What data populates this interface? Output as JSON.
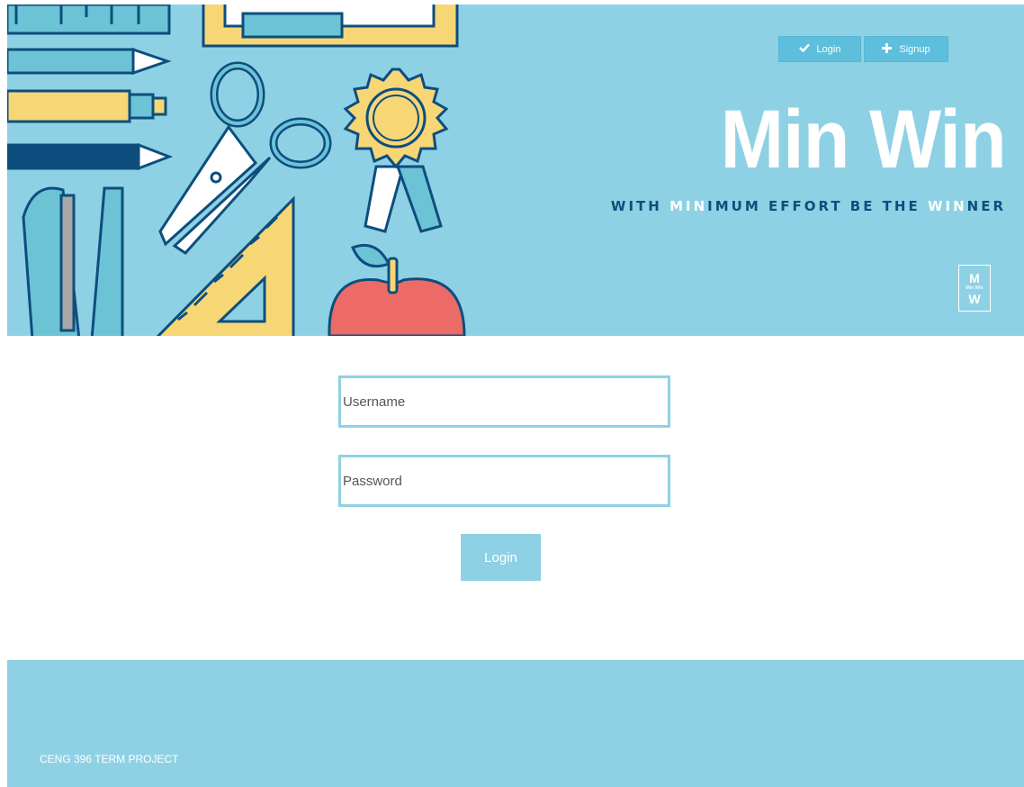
{
  "nav": {
    "login_label": "Login",
    "signup_label": "Signup",
    "login_icon": "check-icon",
    "signup_icon": "plus-icon"
  },
  "brand": {
    "title": "Min Win",
    "tagline_parts": [
      "WITH ",
      "MIN",
      "IMUM EFFORT BE THE ",
      "WIN",
      "NER"
    ],
    "logo_letters": {
      "top": "M",
      "middle": "Min Win",
      "bottom": "W"
    }
  },
  "form": {
    "username_placeholder": "Username",
    "password_placeholder": "Password",
    "submit_label": "Login"
  },
  "footer": {
    "text": "CENG 396 TERM PROJECT"
  },
  "colors": {
    "accent": "#8fd1e4",
    "button": "#5dbfdb",
    "tagline": "#0d4e7e",
    "white": "#ffffff"
  }
}
